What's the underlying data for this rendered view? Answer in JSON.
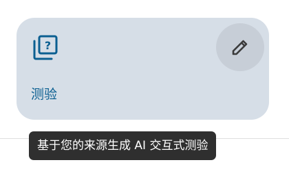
{
  "card": {
    "label": "测验",
    "icon": "quiz-icon",
    "edit_icon": "pencil-icon"
  },
  "tooltip": {
    "text": "基于您的来源生成 AI 交互式测验"
  },
  "colors": {
    "card_background": "#d6dee7",
    "accent": "#0b5f91",
    "edit_button_background": "#c7ced7",
    "tooltip_background": "#2f2f2f"
  }
}
